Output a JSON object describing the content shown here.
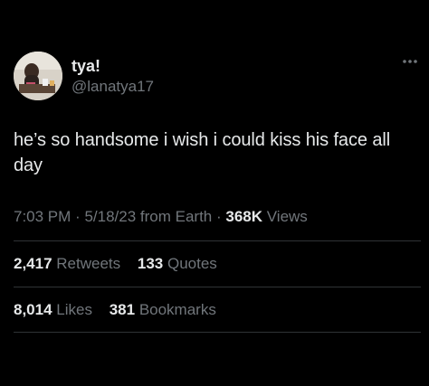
{
  "user": {
    "display_name": "tya!",
    "handle": "@lanatya17",
    "avatar_icon": "profile-photo"
  },
  "more_icon": "ellipsis-icon",
  "tweet": {
    "text": "he’s so handsome i wish i could kiss his face all day",
    "time": "7:03 PM",
    "date": "5/18/23",
    "source": "from Earth",
    "views_count": "368K",
    "views_label": "Views"
  },
  "stats": {
    "retweets_count": "2,417",
    "retweets_label": "Retweets",
    "quotes_count": "133",
    "quotes_label": "Quotes",
    "likes_count": "8,014",
    "likes_label": "Likes",
    "bookmarks_count": "381",
    "bookmarks_label": "Bookmarks"
  },
  "colors": {
    "background": "#000000",
    "primary_text": "#e7e9ea",
    "secondary_text": "#71767b",
    "divider": "#2f3336"
  }
}
